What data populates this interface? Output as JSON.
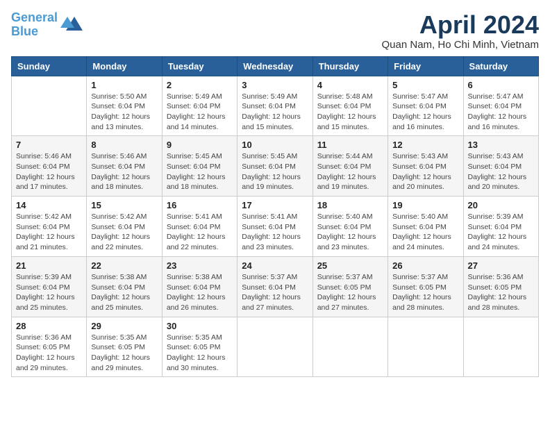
{
  "logo": {
    "line1": "General",
    "line2": "Blue"
  },
  "title": "April 2024",
  "location": "Quan Nam, Ho Chi Minh, Vietnam",
  "weekdays": [
    "Sunday",
    "Monday",
    "Tuesday",
    "Wednesday",
    "Thursday",
    "Friday",
    "Saturday"
  ],
  "weeks": [
    [
      {
        "day": "",
        "info": ""
      },
      {
        "day": "1",
        "info": "Sunrise: 5:50 AM\nSunset: 6:04 PM\nDaylight: 12 hours\nand 13 minutes."
      },
      {
        "day": "2",
        "info": "Sunrise: 5:49 AM\nSunset: 6:04 PM\nDaylight: 12 hours\nand 14 minutes."
      },
      {
        "day": "3",
        "info": "Sunrise: 5:49 AM\nSunset: 6:04 PM\nDaylight: 12 hours\nand 15 minutes."
      },
      {
        "day": "4",
        "info": "Sunrise: 5:48 AM\nSunset: 6:04 PM\nDaylight: 12 hours\nand 15 minutes."
      },
      {
        "day": "5",
        "info": "Sunrise: 5:47 AM\nSunset: 6:04 PM\nDaylight: 12 hours\nand 16 minutes."
      },
      {
        "day": "6",
        "info": "Sunrise: 5:47 AM\nSunset: 6:04 PM\nDaylight: 12 hours\nand 16 minutes."
      }
    ],
    [
      {
        "day": "7",
        "info": "Sunrise: 5:46 AM\nSunset: 6:04 PM\nDaylight: 12 hours\nand 17 minutes."
      },
      {
        "day": "8",
        "info": "Sunrise: 5:46 AM\nSunset: 6:04 PM\nDaylight: 12 hours\nand 18 minutes."
      },
      {
        "day": "9",
        "info": "Sunrise: 5:45 AM\nSunset: 6:04 PM\nDaylight: 12 hours\nand 18 minutes."
      },
      {
        "day": "10",
        "info": "Sunrise: 5:45 AM\nSunset: 6:04 PM\nDaylight: 12 hours\nand 19 minutes."
      },
      {
        "day": "11",
        "info": "Sunrise: 5:44 AM\nSunset: 6:04 PM\nDaylight: 12 hours\nand 19 minutes."
      },
      {
        "day": "12",
        "info": "Sunrise: 5:43 AM\nSunset: 6:04 PM\nDaylight: 12 hours\nand 20 minutes."
      },
      {
        "day": "13",
        "info": "Sunrise: 5:43 AM\nSunset: 6:04 PM\nDaylight: 12 hours\nand 20 minutes."
      }
    ],
    [
      {
        "day": "14",
        "info": "Sunrise: 5:42 AM\nSunset: 6:04 PM\nDaylight: 12 hours\nand 21 minutes."
      },
      {
        "day": "15",
        "info": "Sunrise: 5:42 AM\nSunset: 6:04 PM\nDaylight: 12 hours\nand 22 minutes."
      },
      {
        "day": "16",
        "info": "Sunrise: 5:41 AM\nSunset: 6:04 PM\nDaylight: 12 hours\nand 22 minutes."
      },
      {
        "day": "17",
        "info": "Sunrise: 5:41 AM\nSunset: 6:04 PM\nDaylight: 12 hours\nand 23 minutes."
      },
      {
        "day": "18",
        "info": "Sunrise: 5:40 AM\nSunset: 6:04 PM\nDaylight: 12 hours\nand 23 minutes."
      },
      {
        "day": "19",
        "info": "Sunrise: 5:40 AM\nSunset: 6:04 PM\nDaylight: 12 hours\nand 24 minutes."
      },
      {
        "day": "20",
        "info": "Sunrise: 5:39 AM\nSunset: 6:04 PM\nDaylight: 12 hours\nand 24 minutes."
      }
    ],
    [
      {
        "day": "21",
        "info": "Sunrise: 5:39 AM\nSunset: 6:04 PM\nDaylight: 12 hours\nand 25 minutes."
      },
      {
        "day": "22",
        "info": "Sunrise: 5:38 AM\nSunset: 6:04 PM\nDaylight: 12 hours\nand 25 minutes."
      },
      {
        "day": "23",
        "info": "Sunrise: 5:38 AM\nSunset: 6:04 PM\nDaylight: 12 hours\nand 26 minutes."
      },
      {
        "day": "24",
        "info": "Sunrise: 5:37 AM\nSunset: 6:04 PM\nDaylight: 12 hours\nand 27 minutes."
      },
      {
        "day": "25",
        "info": "Sunrise: 5:37 AM\nSunset: 6:05 PM\nDaylight: 12 hours\nand 27 minutes."
      },
      {
        "day": "26",
        "info": "Sunrise: 5:37 AM\nSunset: 6:05 PM\nDaylight: 12 hours\nand 28 minutes."
      },
      {
        "day": "27",
        "info": "Sunrise: 5:36 AM\nSunset: 6:05 PM\nDaylight: 12 hours\nand 28 minutes."
      }
    ],
    [
      {
        "day": "28",
        "info": "Sunrise: 5:36 AM\nSunset: 6:05 PM\nDaylight: 12 hours\nand 29 minutes."
      },
      {
        "day": "29",
        "info": "Sunrise: 5:35 AM\nSunset: 6:05 PM\nDaylight: 12 hours\nand 29 minutes."
      },
      {
        "day": "30",
        "info": "Sunrise: 5:35 AM\nSunset: 6:05 PM\nDaylight: 12 hours\nand 30 minutes."
      },
      {
        "day": "",
        "info": ""
      },
      {
        "day": "",
        "info": ""
      },
      {
        "day": "",
        "info": ""
      },
      {
        "day": "",
        "info": ""
      }
    ]
  ]
}
